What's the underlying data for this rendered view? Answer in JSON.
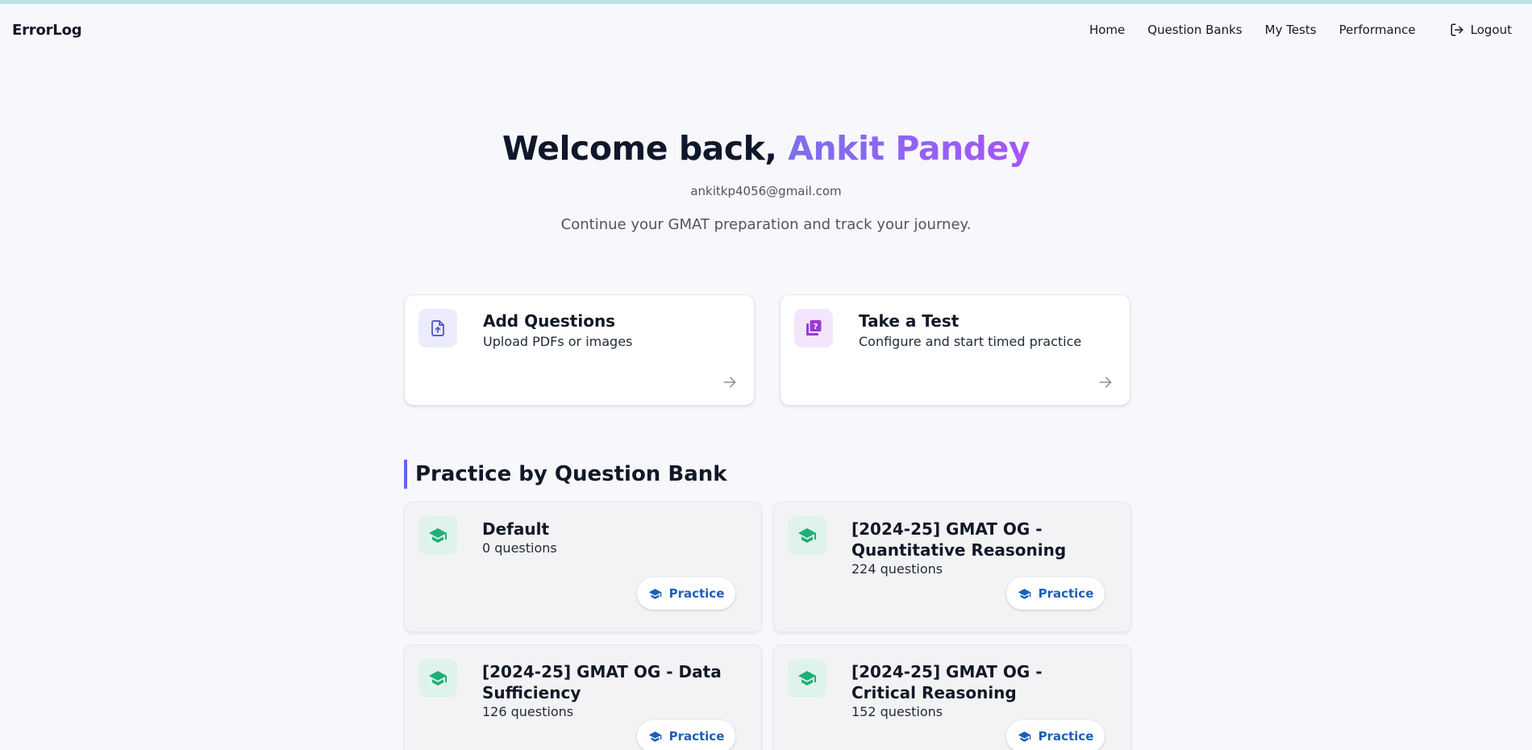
{
  "nav": {
    "brand": "ErrorLog",
    "links": [
      "Home",
      "Question Banks",
      "My Tests",
      "Performance"
    ],
    "logout": "Logout"
  },
  "hero": {
    "welcome_prefix": "Welcome back,",
    "user_name": "Ankit Pandey",
    "email": "ankitkp4056@gmail.com",
    "tagline": "Continue your GMAT preparation and track your journey."
  },
  "actions": [
    {
      "title": "Add Questions",
      "subtitle": "Upload PDFs or images",
      "icon": "upload-file-icon"
    },
    {
      "title": "Take a Test",
      "subtitle": "Configure and start timed practice",
      "icon": "quiz-icon"
    }
  ],
  "section": {
    "title": "Practice by Question Bank"
  },
  "banks": [
    {
      "title": "Default",
      "count": "0 questions",
      "button": "Practice"
    },
    {
      "title": "[2024-25] GMAT OG - Quantitative Reasoning",
      "count": "224 questions",
      "button": "Practice"
    },
    {
      "title": "[2024-25] GMAT OG - Data Sufficiency",
      "count": "126 questions",
      "button": "Practice"
    },
    {
      "title": "[2024-25] GMAT OG - Critical Reasoning",
      "count": "152 questions",
      "button": "Practice"
    }
  ],
  "colors": {
    "accent_indigo": "#6366f1",
    "name_gradient_start": "#7c6ff0",
    "name_gradient_end": "#a855f7",
    "bank_icon_green": "#1fae7a",
    "practice_blue": "#1d5fb8"
  }
}
